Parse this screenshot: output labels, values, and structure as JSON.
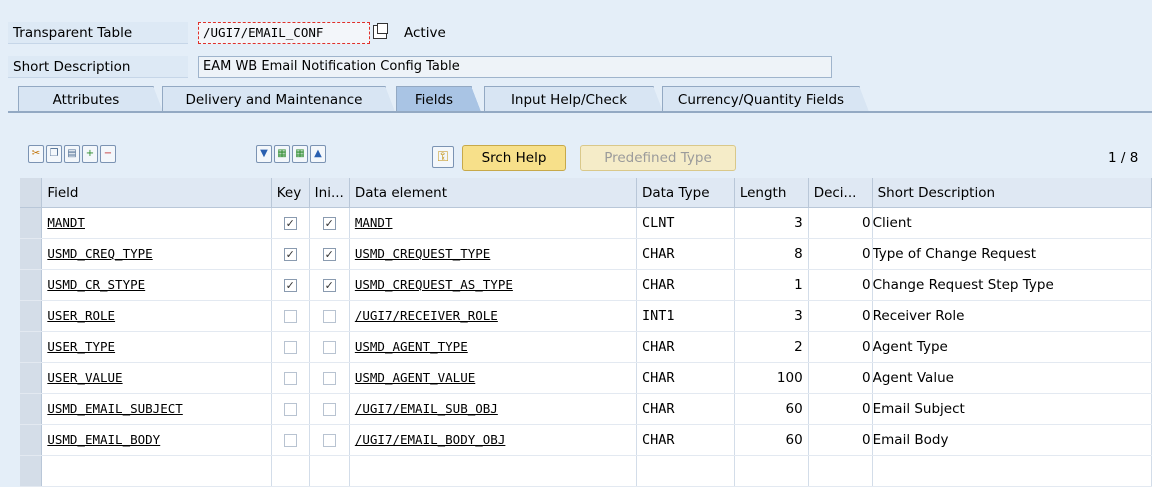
{
  "header": {
    "table_type_label": "Transparent Table",
    "table_name": "/UGI7/EMAIL_CONF",
    "status": "Active",
    "short_desc_label": "Short Description",
    "short_desc_value": "EAM WB Email Notification Config Table"
  },
  "tabs": [
    {
      "label": "Attributes",
      "active": false
    },
    {
      "label": "Delivery and Maintenance",
      "active": false
    },
    {
      "label": "Fields",
      "active": true
    },
    {
      "label": "Input Help/Check",
      "active": false
    },
    {
      "label": "Currency/Quantity Fields",
      "active": false
    }
  ],
  "toolbar": {
    "srch_help_label": "Srch Help",
    "predefined_type_label": "Predefined Type",
    "page_indicator": "1 / 8"
  },
  "grid": {
    "columns": [
      "Field",
      "Key",
      "Ini...",
      "Data element",
      "Data Type",
      "Length",
      "Deci...",
      "Short Description"
    ],
    "rows": [
      {
        "field": "MANDT",
        "key": true,
        "init": true,
        "data_element": "MANDT",
        "data_type": "CLNT",
        "length": "3",
        "decimals": "0",
        "short_desc": "Client"
      },
      {
        "field": "USMD_CREQ_TYPE",
        "key": true,
        "init": true,
        "data_element": "USMD_CREQUEST_TYPE",
        "data_type": "CHAR",
        "length": "8",
        "decimals": "0",
        "short_desc": "Type of Change Request"
      },
      {
        "field": "USMD_CR_STYPE",
        "key": true,
        "init": true,
        "data_element": "USMD_CREQUEST_AS_TYPE",
        "data_type": "CHAR",
        "length": "1",
        "decimals": "0",
        "short_desc": "Change Request Step Type"
      },
      {
        "field": "USER_ROLE",
        "key": false,
        "init": false,
        "data_element": "/UGI7/RECEIVER_ROLE",
        "data_type": "INT1",
        "length": "3",
        "decimals": "0",
        "short_desc": "Receiver Role"
      },
      {
        "field": "USER_TYPE",
        "key": false,
        "init": false,
        "data_element": "USMD_AGENT_TYPE",
        "data_type": "CHAR",
        "length": "2",
        "decimals": "0",
        "short_desc": "Agent Type"
      },
      {
        "field": "USER_VALUE",
        "key": false,
        "init": false,
        "data_element": "USMD_AGENT_VALUE",
        "data_type": "CHAR",
        "length": "100",
        "decimals": "0",
        "short_desc": "Agent Value"
      },
      {
        "field": "USMD_EMAIL_SUBJECT",
        "key": false,
        "init": false,
        "data_element": "/UGI7/EMAIL_SUB_OBJ",
        "data_type": "CHAR",
        "length": "60",
        "decimals": "0",
        "short_desc": "Email Subject"
      },
      {
        "field": "USMD_EMAIL_BODY",
        "key": false,
        "init": false,
        "data_element": "/UGI7/EMAIL_BODY_OBJ",
        "data_type": "CHAR",
        "length": "60",
        "decimals": "0",
        "short_desc": "Email Body"
      }
    ]
  },
  "colors": {
    "background": "#e4eef8",
    "tab_active": "#a9c4e4",
    "button_yellow": "#f7e08a",
    "focus_red": "#e0302a"
  }
}
